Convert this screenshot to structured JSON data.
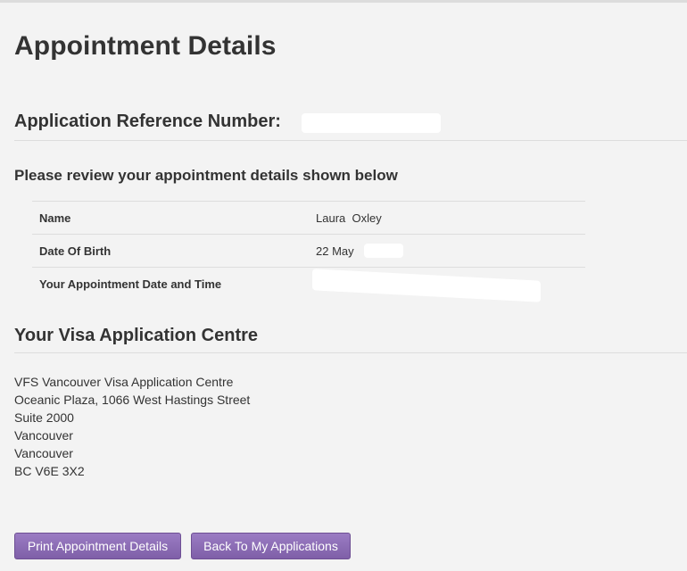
{
  "page": {
    "title": "Appointment Details"
  },
  "reference": {
    "label": "Application Reference Number:"
  },
  "review": {
    "heading": "Please review your appointment details shown below",
    "rows": [
      {
        "label": "Name",
        "value": "Laura  Oxley"
      },
      {
        "label": "Date Of Birth",
        "value": "22 May"
      },
      {
        "label": "Your Appointment Date and Time",
        "value": ""
      }
    ]
  },
  "centre": {
    "heading": "Your Visa Application Centre",
    "address": [
      "VFS Vancouver Visa Application Centre",
      "Oceanic Plaza, 1066 West Hastings Street",
      "Suite 2000",
      "Vancouver",
      "Vancouver",
      "BC V6E 3X2"
    ]
  },
  "buttons": {
    "print_label": "Print Appointment Details",
    "back_label": "Back To My Applications"
  },
  "colors": {
    "button_bg": "#8a6bb3",
    "background": "#f3f3f3",
    "text": "#333333"
  }
}
